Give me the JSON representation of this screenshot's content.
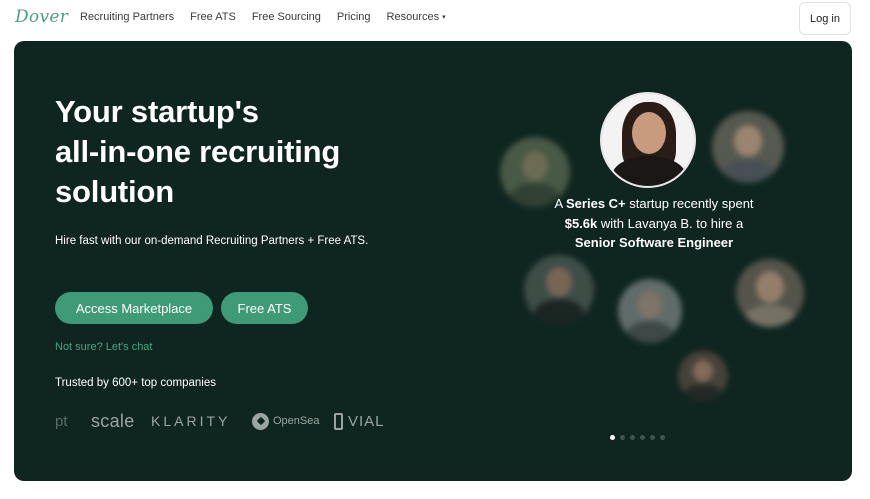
{
  "nav": {
    "logo": "Dover",
    "links": [
      "Recruiting Partners",
      "Free ATS",
      "Free Sourcing",
      "Pricing",
      "Resources"
    ],
    "resources_caret": "▾",
    "login": "Log in"
  },
  "hero": {
    "headline": [
      "Your startup's",
      "all-in-one recruiting",
      "solution"
    ],
    "subtitle": "Hire fast with our on-demand Recruiting Partners + Free ATS.",
    "primary_button": "Access Marketplace",
    "secondary_button": "Free ATS",
    "chat_link": "Not sure? Let's chat",
    "trusted": "Trusted by 600+ top companies",
    "company_logos": [
      "pt",
      "scale",
      "KLARITY",
      "OpenSea",
      "VIAL"
    ]
  },
  "testimonial": {
    "caption_parts": {
      "a": "A ",
      "stage": "Series C+",
      "b": " startup recently spent ",
      "amount": "$5.6k",
      "c": " with Lavanya B. to hire a ",
      "role": "Senior Software Engineer"
    },
    "carousel": {
      "total": 6,
      "active": 1
    }
  },
  "colors": {
    "hero_bg": "#0f2620",
    "accent": "#3f9a77",
    "brand_green": "#4aa37d"
  }
}
